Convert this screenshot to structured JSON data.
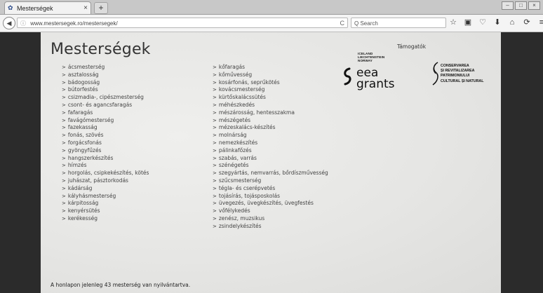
{
  "browser": {
    "tab_title": "Mesterségek",
    "tab_close": "×",
    "new_tab": "+",
    "window_controls": [
      "–",
      "□",
      "×"
    ],
    "back": "◀",
    "url": "www.mestersegek.ro/mestersegek/",
    "info": "ⓘ",
    "reload": "C",
    "search_placeholder": "Search",
    "search_icon": "Q",
    "toolbar_icons": [
      "star-icon",
      "reading-list-icon",
      "pocket-icon",
      "download-icon",
      "home-icon",
      "sync-icon",
      "menu-icon"
    ],
    "toolbar_glyphs": [
      "☆",
      "▣",
      "♡",
      "⬇",
      "⌂",
      "⟳",
      "≡"
    ]
  },
  "page": {
    "title": "Mesterségek",
    "sponsors_label": "Támogatók",
    "column1": [
      "ácsmesterség",
      "asztalosság",
      "bádogosság",
      "bútorfestés",
      "csizmadia-, cipészmesterség",
      "csont- és agancsfaragás",
      "fafaragás",
      "favágómesterség",
      "fazekasság",
      "fonás, szövés",
      "forgácsfonás",
      "gyöngyfűzés",
      "hangszerkészítés",
      "hímzés",
      "horgolás, csipkekészítés, kötés",
      "juhászat, pásztorkodás",
      "kádárság",
      "kályhásmesterség",
      "kárpitosság",
      "kenyérsütés",
      "kerékesség"
    ],
    "column2": [
      "kőfaragás",
      "kőművesség",
      "kosárfonás, seprűkötés",
      "kovácsmesterség",
      "kürtőskalácssütés",
      "méhészkedés",
      "mészárosság, hentesszakma",
      "mészégetés",
      "mézeskalács-készítés",
      "molnárság",
      "nemezkészítés",
      "pálinkafőzés",
      "szabás, varrás",
      "szénégetés",
      "szegyártás, nemvarrás, bőrdíszművesség",
      "szűcsmesterség",
      "tégla- és cserépvetés",
      "tojásírás, tojásposkolás",
      "üvegezés, üvegkészítés, üvegfestés",
      "vőfélykedés",
      "zenész, muzsikus",
      "zsindelykészítés"
    ],
    "eea": {
      "small_lines": [
        "ICELAND",
        "LIECHTENSTEIN",
        "NORWAY"
      ],
      "word1": "eea",
      "word2": "grants"
    },
    "partner": {
      "lines": [
        "CONSERVAREA",
        "ȘI REVITALIZAREA",
        "PATRIMONIULUI",
        "CULTURAL ȘI NATURAL"
      ]
    },
    "footer": "A honlapon jelenleg 43 mesterség van nyilvántartva."
  }
}
